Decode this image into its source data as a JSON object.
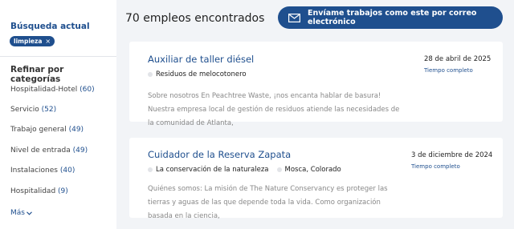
{
  "sidebar": {
    "current_search_title": "Búsqueda actual",
    "chip_label": "limpieza",
    "chip_close": "×",
    "refine_title": "Refinar por categorías",
    "categories": [
      {
        "label": "Hospitalidad-Hotel",
        "count": "(60)"
      },
      {
        "label": "Servicio",
        "count": "(52)"
      },
      {
        "label": "Trabajo general",
        "count": "(49)"
      },
      {
        "label": "Nivel de entrada",
        "count": "(49)"
      },
      {
        "label": "Instalaciones",
        "count": "(40)"
      },
      {
        "label": "Hospitalidad",
        "count": "(9)"
      }
    ],
    "more_label": "Más"
  },
  "header": {
    "results_count": "70 empleos encontrados",
    "email_button_label": "Envíame trabajos como este por correo electrónico",
    "email_icon": "envelope-icon"
  },
  "jobs": [
    {
      "title": "Auxiliar de taller diésel",
      "company": "Residuos de melocotonero",
      "location": "",
      "date": "28 de abril de 2025",
      "type": "Tiempo completo",
      "description": "Sobre nosotros En Peachtree Waste, ¡nos encanta hablar de basura! Nuestra empresa local de gestión de residuos atiende las necesidades de la comunidad de Atlanta,"
    },
    {
      "title": "Cuidador de la Reserva Zapata",
      "company": "La conservación de la naturaleza",
      "location": "Mosca, Colorado",
      "date": "3 de diciembre de 2024",
      "type": "Tiempo completo",
      "description": "Quiénes somos: La misión de The Nature Conservancy es proteger las tierras y aguas de las que depende toda la vida. Como organización basada en la ciencia,"
    }
  ]
}
